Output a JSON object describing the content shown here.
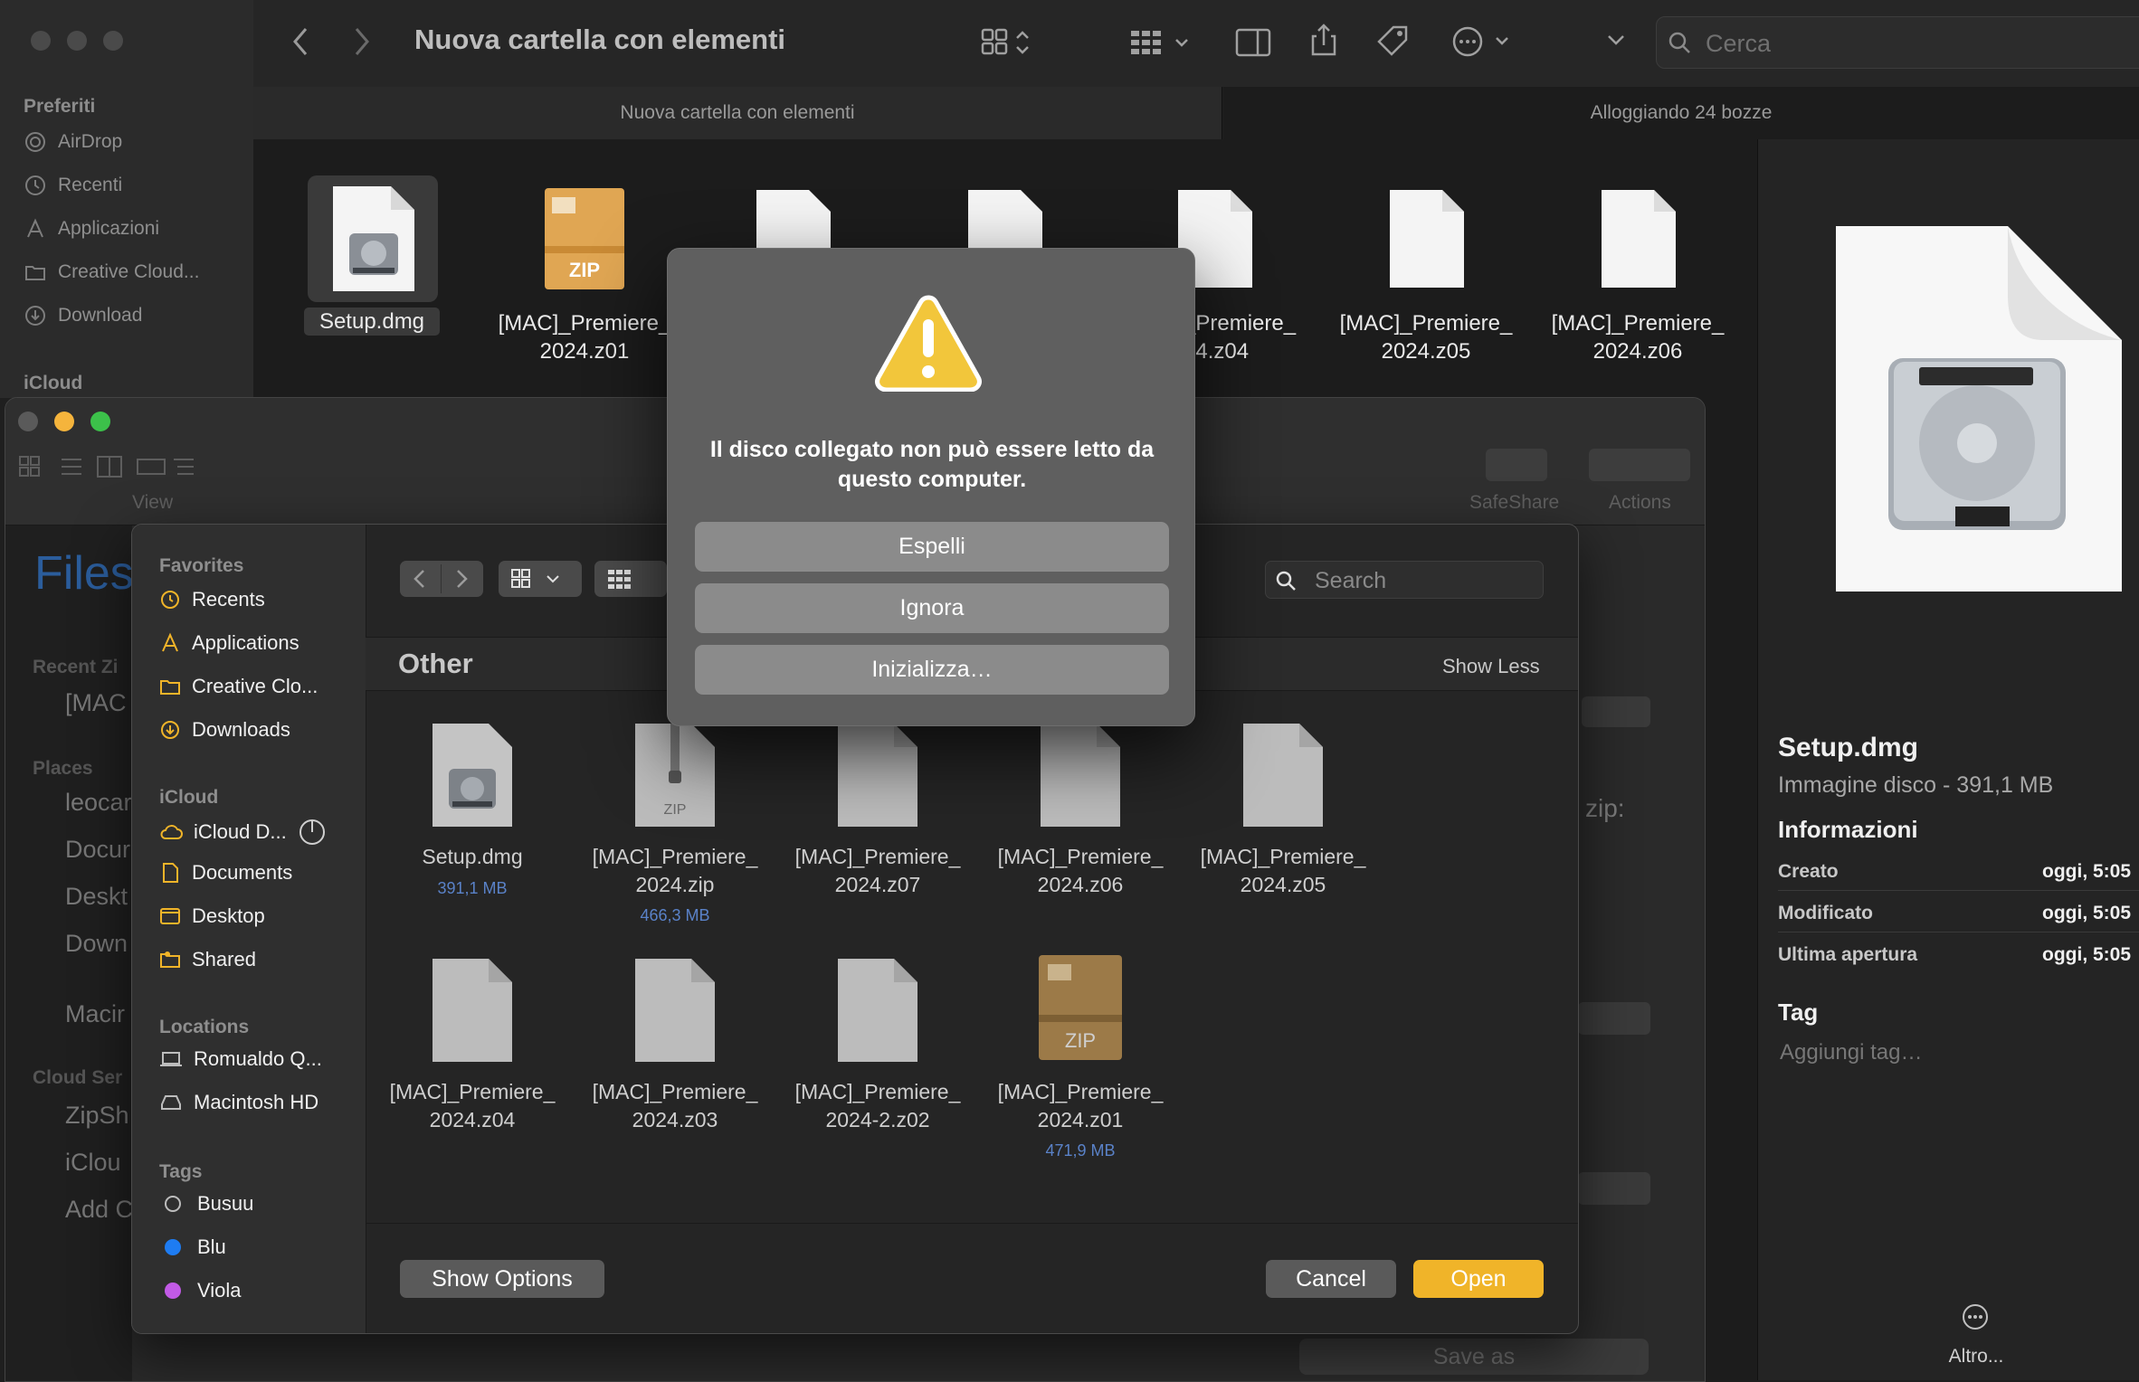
{
  "finder": {
    "title": "Nuova cartella con elementi",
    "search_placeholder": "Cerca",
    "sidebar": {
      "favorites_header": "Preferiti",
      "items": [
        "AirDrop",
        "Recenti",
        "Applicazioni",
        "Creative Cloud...",
        "Download"
      ],
      "icloud_header": "iCloud"
    },
    "tabs": [
      "Nuova cartella con elementi",
      "Alloggiando 24 bozze"
    ],
    "files": [
      {
        "l1": "Setup.dmg",
        "l2": ""
      },
      {
        "l1": "[MAC]_Premiere_",
        "l2": "2024.z01"
      },
      {
        "l1": "_Premiere_",
        "l2": "24.z04"
      },
      {
        "l1": "[MAC]_Premiere_",
        "l2": "2024.z05"
      },
      {
        "l1": "[MAC]_Premiere_",
        "l2": "2024.z06"
      }
    ],
    "zip_badge": "ZIP",
    "preview": {
      "name": "Setup.dmg",
      "kind": "Immagine disco - 391,1 MB",
      "info_header": "Informazioni",
      "rows": [
        {
          "label": "Creato",
          "value": "oggi, 5:05"
        },
        {
          "label": "Modificato",
          "value": "oggi, 5:05"
        },
        {
          "label": "Ultima apertura",
          "value": "oggi, 5:05"
        }
      ],
      "tag_header": "Tag",
      "tag_placeholder": "Aggiungi tag…",
      "more_label": "Altro..."
    }
  },
  "app": {
    "toolbar_view": "View",
    "safeshare": "SafeShare",
    "actions": "Actions",
    "files_title": "Files",
    "recent_header": "Recent Zi",
    "recent_item": "[MAC",
    "places_header": "Places",
    "places": [
      "leocar",
      "Docur",
      "Deskt",
      "Down",
      "Macir"
    ],
    "cloud_header": "Cloud Ser",
    "cloud": [
      "ZipSh",
      "iClou",
      "Add C"
    ],
    "zip_label": "zip:",
    "save_as": "Save as"
  },
  "open_dialog": {
    "sidebar": {
      "favorites_header": "Favorites",
      "favorites": [
        "Recents",
        "Applications",
        "Creative Clo...",
        "Downloads"
      ],
      "icloud_header": "iCloud",
      "icloud": [
        "iCloud D...",
        "Documents",
        "Desktop",
        "Shared"
      ],
      "locations_header": "Locations",
      "locations": [
        "Romualdo Q...",
        "Macintosh HD"
      ],
      "tags_header": "Tags",
      "tags": [
        {
          "name": "Busuu",
          "color": "#00000000"
        },
        {
          "name": "Blu",
          "color": "#1e7cf2"
        },
        {
          "name": "Viola",
          "color": "#c25ae6"
        }
      ]
    },
    "search_placeholder": "Search",
    "section_title": "Other",
    "show_less": "Show Less",
    "files": [
      {
        "l1": "Setup.dmg",
        "l2": "",
        "size": "391,1 MB"
      },
      {
        "l1": "[MAC]_Premiere_",
        "l2": "2024.zip",
        "size": "466,3 MB"
      },
      {
        "l1": "[MAC]_Premiere_",
        "l2": "2024.z07",
        "size": ""
      },
      {
        "l1": "[MAC]_Premiere_",
        "l2": "2024.z06",
        "size": ""
      },
      {
        "l1": "[MAC]_Premiere_",
        "l2": "2024.z05",
        "size": ""
      },
      {
        "l1": "[MAC]_Premiere_",
        "l2": "2024.z04",
        "size": ""
      },
      {
        "l1": "[MAC]_Premiere_",
        "l2": "2024.z03",
        "size": ""
      },
      {
        "l1": "[MAC]_Premiere_",
        "l2": "2024-2.z02",
        "size": ""
      },
      {
        "l1": "[MAC]_Premiere_",
        "l2": "2024.z01",
        "size": "471,9 MB"
      }
    ],
    "zip_small": "ZIP",
    "show_options": "Show Options",
    "cancel": "Cancel",
    "open": "Open"
  },
  "alert": {
    "message": "Il disco collegato non può essere letto da questo computer.",
    "buttons": [
      "Espelli",
      "Ignora",
      "Inizializza…"
    ]
  },
  "colors": {
    "accent": "#f0b429",
    "link": "#5a82c8"
  }
}
